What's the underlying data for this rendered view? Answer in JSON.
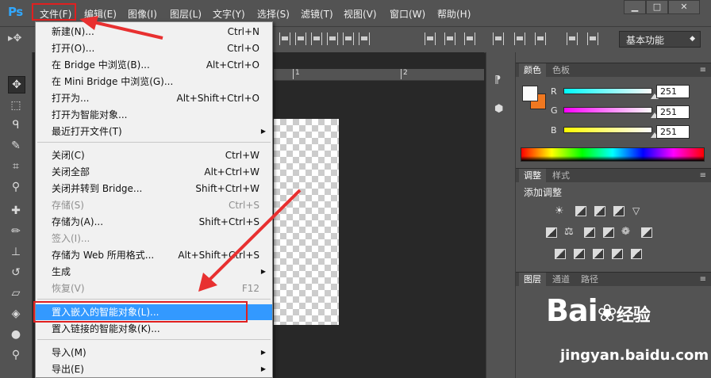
{
  "app": {
    "logo": "Ps"
  },
  "menubar": {
    "items": [
      "文件(F)",
      "编辑(E)",
      "图像(I)",
      "图层(L)",
      "文字(Y)",
      "选择(S)",
      "滤镜(T)",
      "视图(V)",
      "窗口(W)",
      "帮助(H)"
    ],
    "window_controls": [
      "▁",
      "□",
      "✕"
    ]
  },
  "optionsbar": {
    "workspace": "基本功能"
  },
  "ruler": {
    "ticks": [
      "1",
      "2"
    ]
  },
  "file_menu": {
    "items": [
      {
        "label": "新建(N)...",
        "shortcut": "Ctrl+N"
      },
      {
        "label": "打开(O)...",
        "shortcut": "Ctrl+O"
      },
      {
        "label": "在 Bridge 中浏览(B)...",
        "shortcut": "Alt+Ctrl+O"
      },
      {
        "label": "在 Mini Bridge 中浏览(G)...",
        "shortcut": ""
      },
      {
        "label": "打开为...",
        "shortcut": "Alt+Shift+Ctrl+O"
      },
      {
        "label": "打开为智能对象...",
        "shortcut": ""
      },
      {
        "label": "最近打开文件(T)",
        "shortcut": "▶"
      },
      {
        "label": "关闭(C)",
        "shortcut": "Ctrl+W"
      },
      {
        "label": "关闭全部",
        "shortcut": "Alt+Ctrl+W"
      },
      {
        "label": "关闭并转到 Bridge...",
        "shortcut": "Shift+Ctrl+W"
      },
      {
        "label": "存储(S)",
        "shortcut": "Ctrl+S"
      },
      {
        "label": "存储为(A)...",
        "shortcut": "Shift+Ctrl+S"
      },
      {
        "label": "签入(I)...",
        "shortcut": ""
      },
      {
        "label": "存储为 Web 所用格式...",
        "shortcut": "Alt+Shift+Ctrl+S"
      },
      {
        "label": "生成",
        "shortcut": "▶"
      },
      {
        "label": "恢复(V)",
        "shortcut": "F12"
      },
      {
        "label": "置入嵌入的智能对象(L)...",
        "shortcut": ""
      },
      {
        "label": "置入链接的智能对象(K)...",
        "shortcut": ""
      },
      {
        "label": "导入(M)",
        "shortcut": "▶"
      },
      {
        "label": "导出(E)",
        "shortcut": "▶"
      }
    ]
  },
  "color_panel": {
    "tabs": [
      "颜色",
      "色板"
    ],
    "sliders": [
      {
        "label": "R",
        "value": "251",
        "gradient": [
          "#00fbfb",
          "#fbfbfb"
        ]
      },
      {
        "label": "G",
        "value": "251",
        "gradient": [
          "#fb00fb",
          "#fbfbfb"
        ]
      },
      {
        "label": "B",
        "value": "251",
        "gradient": [
          "#fbfb00",
          "#fbfbfb"
        ]
      }
    ],
    "foreground": "#fbfbfb",
    "background": "#f07820"
  },
  "adjustments_panel": {
    "tabs": [
      "调整",
      "样式"
    ],
    "title": "添加调整"
  },
  "layers_panel": {
    "tabs": [
      "图层",
      "通道",
      "路径"
    ]
  },
  "watermark": {
    "logo_text": "Bai",
    "logo_cn": "经验",
    "url": "jingyan.baidu.com"
  }
}
